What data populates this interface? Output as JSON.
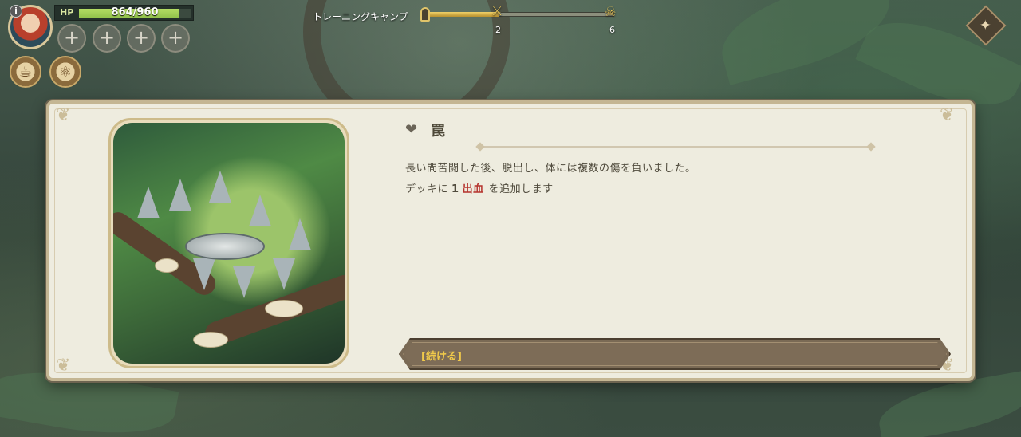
{
  "hud": {
    "info_glyph": "i",
    "hp_label": "HP",
    "hp_text": "864/960",
    "hp_fraction": 0.9,
    "slot_glyph": "+",
    "relics": [
      "cup-relic-icon",
      "potion-relic-icon"
    ]
  },
  "progress": {
    "title": "トレーニングキャンプ",
    "current_node": "2",
    "boss_node": "6",
    "fill_fraction": 0.4
  },
  "event": {
    "title": "罠",
    "description": "長い間苦闘した後、脱出し、体には複数の傷を負いました。",
    "effect_prefix": "デッキに",
    "effect_count": "1",
    "effect_keyword": "出血",
    "effect_suffix": "を追加します",
    "continue_label": "[続ける]"
  },
  "colors": {
    "panel_bg": "#eeecdf",
    "accent_gold": "#f0c94a",
    "keyword_red": "#b5342e",
    "hp_green": "#8fc04a"
  }
}
